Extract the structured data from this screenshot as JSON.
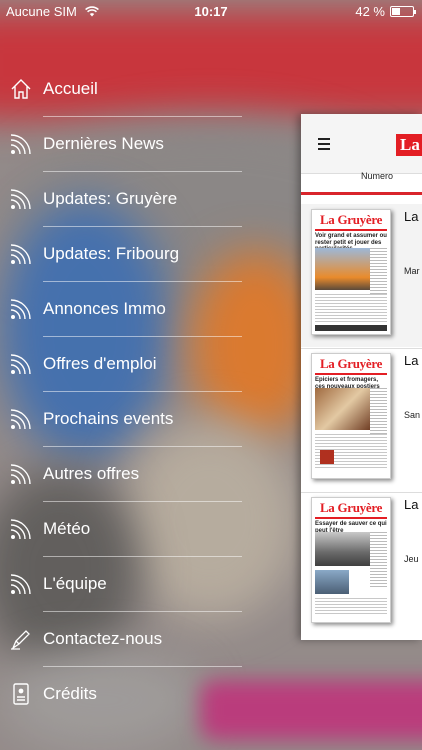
{
  "status_bar": {
    "carrier": "Aucune SIM",
    "time": "10:17",
    "battery": "42 %",
    "battery_level": 0.42
  },
  "menu": {
    "items": [
      {
        "label": "Accueil",
        "icon": "home-icon"
      },
      {
        "label": "Dernières News",
        "icon": "rss-icon"
      },
      {
        "label": "Updates: Gruyère",
        "icon": "rss-icon"
      },
      {
        "label": "Updates: Fribourg",
        "icon": "rss-icon"
      },
      {
        "label": "Annonces Immo",
        "icon": "rss-icon"
      },
      {
        "label": "Offres d'emploi",
        "icon": "rss-icon"
      },
      {
        "label": "Prochains events",
        "icon": "rss-icon"
      },
      {
        "label": "Autres offres",
        "icon": "rss-icon"
      },
      {
        "label": "Météo",
        "icon": "rss-icon"
      },
      {
        "label": "L'équipe",
        "icon": "rss-icon"
      },
      {
        "label": "Contactez-nous",
        "icon": "pen-icon"
      },
      {
        "label": "Crédits",
        "icon": "id-card-icon"
      }
    ]
  },
  "app_panel": {
    "logo": "La",
    "tab": "Numero",
    "issues": [
      {
        "name": "La",
        "date": "Mar",
        "paper_title": "La Gruyère",
        "headline": "Voir grand et assumer ou rester petit et jouer des particularités"
      },
      {
        "name": "La",
        "date": "San",
        "paper_title": "La Gruyère",
        "headline": "Epiciers et fromagers, ces nouveaux postiers"
      },
      {
        "name": "La",
        "date": "Jeu",
        "paper_title": "La Gruyère",
        "headline": "Essayer de sauver ce qui peut l'être"
      }
    ]
  },
  "colors": {
    "brand_red": "#e31e24",
    "tab_underline": "#d9242b"
  }
}
